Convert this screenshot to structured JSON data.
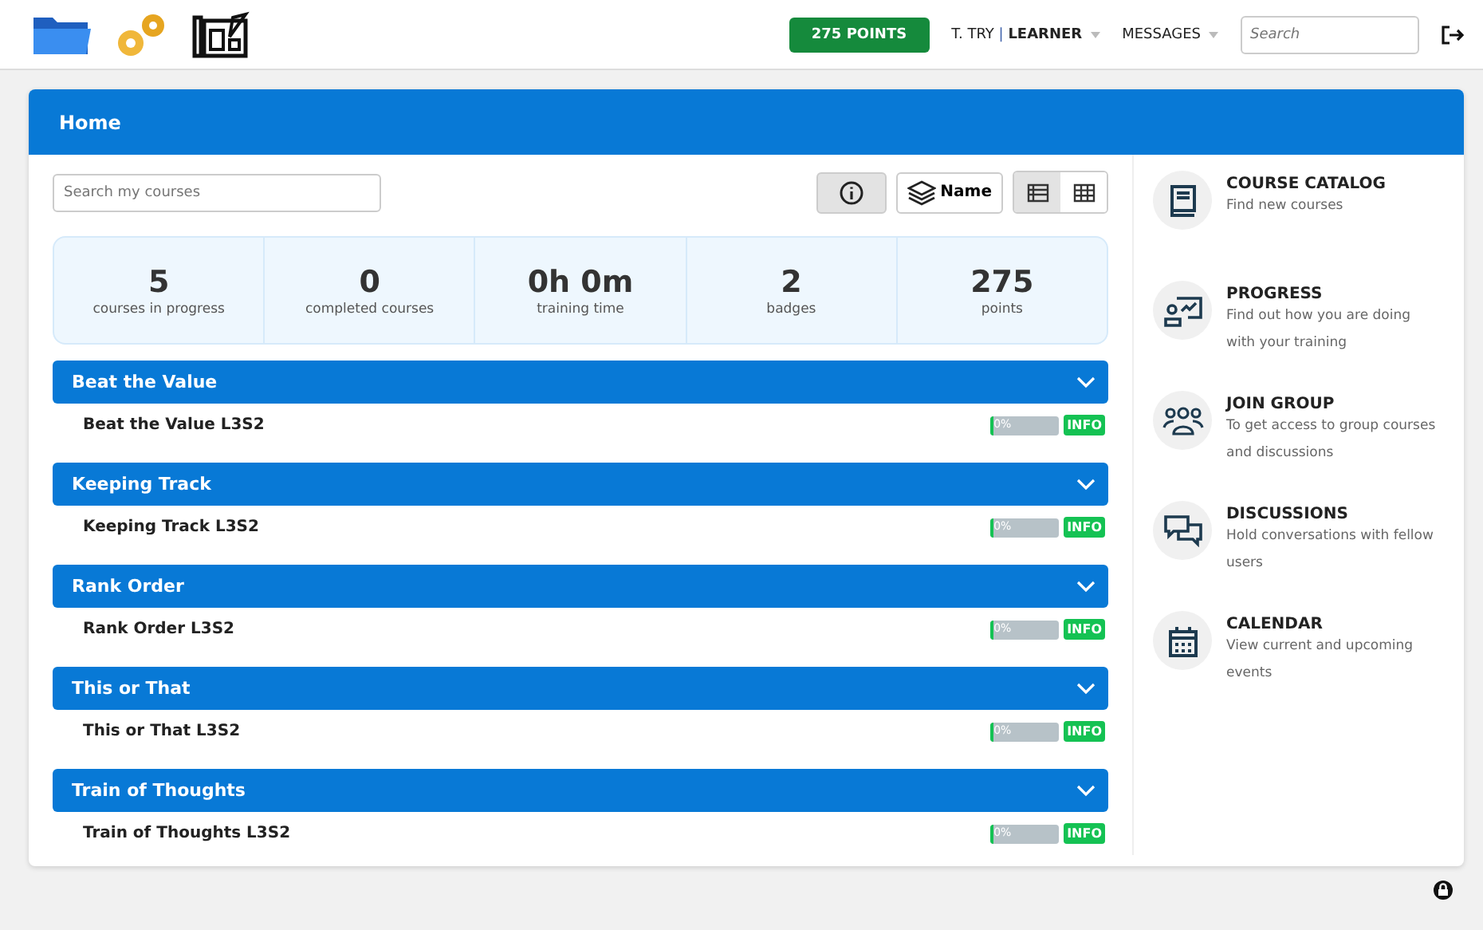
{
  "topbar": {
    "points": "275 POINTS",
    "user": "T. TRY",
    "separator": "|",
    "role": "LEARNER",
    "messages": "MESSAGES",
    "search": {
      "placeholder": "Search"
    }
  },
  "panel": {
    "title": "Home"
  },
  "course_search": {
    "placeholder": "Search my courses"
  },
  "toolbar": {
    "info_selected": true,
    "sort_label": "Name",
    "views": [
      {
        "kind": "list",
        "selected": true
      },
      {
        "kind": "grid",
        "selected": false
      }
    ]
  },
  "stats": [
    {
      "value": "5",
      "label": "courses in progress"
    },
    {
      "value": "0",
      "label": "completed courses"
    },
    {
      "value": "0h 0m",
      "label": "training time"
    },
    {
      "value": "2",
      "label": "badges"
    },
    {
      "value": "275",
      "label": "points"
    }
  ],
  "groups": [
    {
      "title": "Beat the Value",
      "expanded": true,
      "courses": [
        {
          "name": "Beat the Value L3S2",
          "level": 0,
          "progress": "0%",
          "info": "INFO"
        }
      ]
    },
    {
      "title": "Keeping Track",
      "expanded": true,
      "courses": [
        {
          "name": "Keeping Track L3S2",
          "level": 0,
          "progress": "0%",
          "info": "INFO"
        }
      ]
    },
    {
      "title": "Rank Order",
      "expanded": true,
      "courses": [
        {
          "name": "Rank Order L3S2",
          "level": 0,
          "progress": "0%",
          "info": "INFO"
        }
      ]
    },
    {
      "title": "This or That",
      "expanded": true,
      "courses": [
        {
          "name": "This or That L3S2",
          "level": 0,
          "progress": "0%",
          "info": "INFO"
        }
      ]
    },
    {
      "title": "Train of Thoughts",
      "expanded": true,
      "courses": [
        {
          "name": "Train of Thoughts L3S2",
          "level": 0,
          "progress": "0%",
          "info": "INFO"
        }
      ]
    }
  ],
  "sidebar": {
    "items": [
      {
        "kind": "catalog",
        "title": "COURSE CATALOG",
        "description": "Find new courses"
      },
      {
        "kind": "progress",
        "title": "PROGRESS",
        "description": "Find out how you are doing with your training"
      },
      {
        "kind": "group",
        "title": "JOIN GROUP",
        "description": "To get access to group courses and discussions"
      },
      {
        "kind": "discussions",
        "title": "DISCUSSIONS",
        "description": "Hold conversations with fellow users"
      },
      {
        "kind": "calendar",
        "title": "CALENDAR",
        "description": "View current and upcoming events"
      }
    ]
  }
}
